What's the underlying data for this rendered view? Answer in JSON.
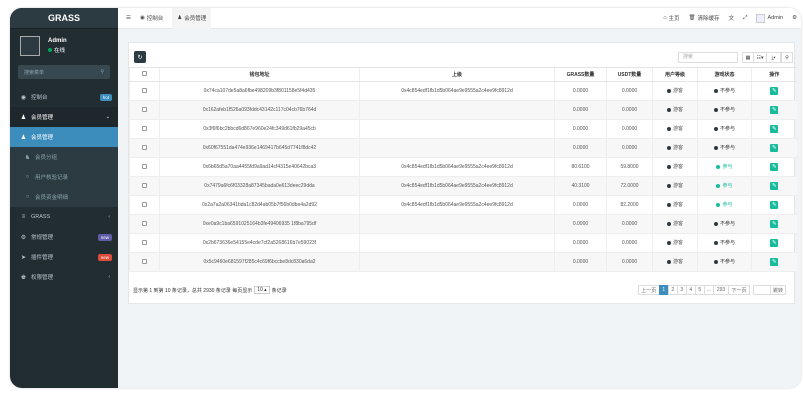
{
  "sidebar": {
    "logo": "GRASS",
    "user": {
      "name": "Admin",
      "status": "在线"
    },
    "search_placeholder": "搜索菜单",
    "items": [
      {
        "label": "控制台",
        "icon": "dashboard-icon",
        "badge": "hot",
        "badge_color": "#3c8dbc",
        "state": "normal"
      },
      {
        "label": "会员管理",
        "icon": "user-icon",
        "state": "open"
      },
      {
        "label": "会员管理",
        "icon": "user-icon",
        "state": "active"
      },
      {
        "label": "会员分组",
        "icon": "users-icon",
        "state": "sub"
      },
      {
        "label": "用户核验记录",
        "icon": "circle-icon",
        "state": "sub"
      },
      {
        "label": "会员资金明细",
        "icon": "circle-icon",
        "state": "sub"
      },
      {
        "label": "GRASS",
        "icon": "list-icon",
        "state": "normal",
        "caret": true
      },
      {
        "label": "常规管理",
        "icon": "cogs-icon",
        "badge": "new",
        "badge_color": "#605ca8",
        "state": "normal"
      },
      {
        "label": "插件管理",
        "icon": "rocket-icon",
        "badge": "new",
        "badge_color": "#dd4b39",
        "state": "normal"
      },
      {
        "label": "权限管理",
        "icon": "group-icon",
        "state": "normal",
        "caret": true
      }
    ]
  },
  "topbar": {
    "tabs": [
      {
        "label": "控制台",
        "icon": "dashboard-icon"
      },
      {
        "label": "会员管理",
        "icon": "user-icon"
      }
    ],
    "right": {
      "home": "主页",
      "clear_cache": "清除缓存",
      "admin": "Admin"
    }
  },
  "toolbar": {
    "search_placeholder": "搜索",
    "refresh_icon": "refresh-icon"
  },
  "table": {
    "headers": [
      "钱包地址",
      "上级",
      "GRASS数量",
      "USDT数量",
      "用户等级",
      "游戏状态",
      "操作"
    ],
    "rows": [
      {
        "wallet": "0x74ca107de5a8a6fbe498209b3f801158e5f4d435",
        "parent": "0x4c854edf1fb1d5b064ae9e9555a2c4ee9fc8912d",
        "grass": "0.0000",
        "usdt": "0.0000",
        "level": "游客",
        "status": "不参与",
        "participating": false
      },
      {
        "wallet": "0x162afeb1f526a093fddc43142c117c04cb76b764d",
        "parent": "",
        "grass": "0.0000",
        "usdt": "0.0000",
        "level": "游客",
        "status": "不参与",
        "participating": false
      },
      {
        "wallet": "0x3f6f6bc2bbcd6d867e960e24fc349d61fb29a45cb",
        "parent": "",
        "grass": "0.0000",
        "usdt": "0.0000",
        "level": "游客",
        "status": "不参与",
        "participating": false
      },
      {
        "wallet": "0x60f67551da474e936e1469417b645d7741f8dc42",
        "parent": "",
        "grass": "0.0000",
        "usdt": "0.0000",
        "level": "游客",
        "status": "不参与",
        "participating": false
      },
      {
        "wallet": "0x6b65d5a70aa4455fd9a9ad14cf4315e40642bca3",
        "parent": "0x4c854edf1fb1d5b064ae9e9555a2c4ee9fc8912d",
        "grass": "80.6100",
        "usdt": "59.8000",
        "level": "游客",
        "status": "参与",
        "participating": true
      },
      {
        "wallet": "0x7479a6fc6f03328a87345bada0e613deec29dda",
        "parent": "0x4c854edf1fb1d5b064ae9e9555a2c4ee9fc8912d",
        "grass": "40.3100",
        "usdt": "72.0000",
        "level": "游客",
        "status": "参与",
        "participating": true
      },
      {
        "wallet": "0x2a7a2a06341bda1c82d4ab05b7f56b0dbe4a2d92",
        "parent": "0x4c854edf1fb1d5b064ae9e9555a2c4ee9fc8912d",
        "grass": "0.0000",
        "usdt": "82.2000",
        "level": "游客",
        "status": "参与",
        "participating": true
      },
      {
        "wallet": "0xe0a9c1ba6591025164b3fe49406935 1f8ba795df",
        "parent": "",
        "grass": "0.0000",
        "usdt": "0.0000",
        "level": "游客",
        "status": "不参与",
        "participating": false
      },
      {
        "wallet": "0x2b673636e54155e4cde7cf2a5268616b7e59023f",
        "parent": "",
        "grass": "0.0000",
        "usdt": "0.0000",
        "level": "游客",
        "status": "不参与",
        "participating": false
      },
      {
        "wallet": "0x5c9460e681597f285c4c69f6bccbe8dc830a6da2",
        "parent": "",
        "grass": "0.0000",
        "usdt": "0.0000",
        "level": "游客",
        "status": "不参与",
        "participating": false
      }
    ]
  },
  "pagination": {
    "info_prefix": "显示第 1 到第 10 条记录，总共 2930 条记录 每页显示",
    "page_size": "10",
    "info_suffix": "条记录",
    "prev": "上一页",
    "pages": [
      "1",
      "2",
      "3",
      "4",
      "5",
      "...",
      "293"
    ],
    "current": "1",
    "next": "下一页",
    "jump": "跳转"
  },
  "colors": {
    "sidebar_bg": "#222d32",
    "active": "#3c8dbc",
    "status_on": "#18bc9c",
    "status_off": "#2c3b41",
    "edit": "#18bc9c"
  }
}
